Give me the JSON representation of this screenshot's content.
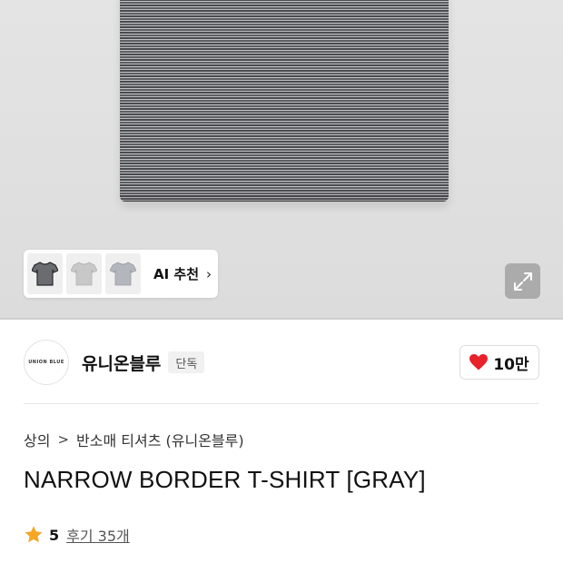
{
  "recommendation": {
    "label": "AI 추천",
    "chevron": "›"
  },
  "brand": {
    "logo_text": "UNION BLUE",
    "name": "유니온블루",
    "badge": "단독"
  },
  "like": {
    "count": "10만",
    "icon": "heart-icon",
    "color": "#e8212a"
  },
  "breadcrumb": {
    "items": [
      "상의",
      "반소매 티셔츠 (유니온블루)"
    ],
    "separator": ">"
  },
  "product": {
    "title": "NARROW BORDER T-SHIRT [GRAY]"
  },
  "rating": {
    "score": "5",
    "reviews": "후기 35개",
    "star_color": "#f5a623"
  }
}
